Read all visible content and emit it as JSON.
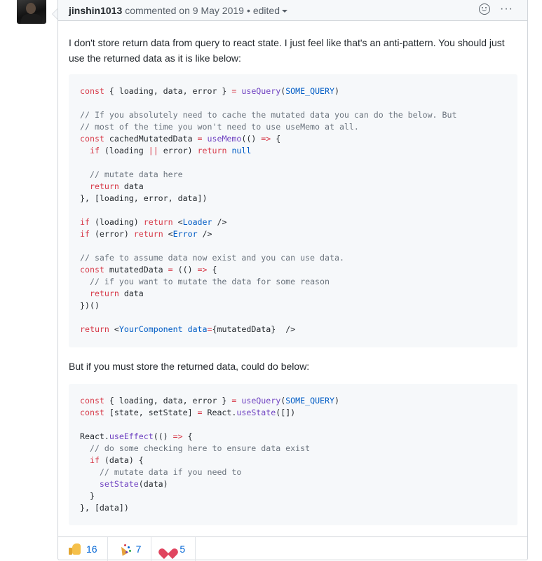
{
  "comment": {
    "author": "jinshin1013",
    "action": "commented on",
    "date": "9 May 2019",
    "separator": "•",
    "edited_label": "edited",
    "actions": {
      "react_icon": "smiley-icon",
      "more_icon": "kebab-horizontal-icon",
      "more_label": "···"
    }
  },
  "body": {
    "paragraph1": "I don't store return data from query to react state. I just feel like that's an anti-pattern. You should just use the returned data as it is like below:",
    "paragraph2": "But if you must store the returned data, could do below:"
  },
  "reactions": [
    {
      "icon": "thumbs-up-icon",
      "count": "16"
    },
    {
      "icon": "tada-icon",
      "count": "7"
    },
    {
      "icon": "heart-icon",
      "count": "5"
    }
  ],
  "colors": {
    "keyword": "#d73a49",
    "function": "#6f42c1",
    "comment": "#6a737d",
    "tag": "#22863a",
    "constant": "#005cc5",
    "link": "#0366d6",
    "border": "#d1d5da",
    "code_bg": "#f6f8fa"
  }
}
